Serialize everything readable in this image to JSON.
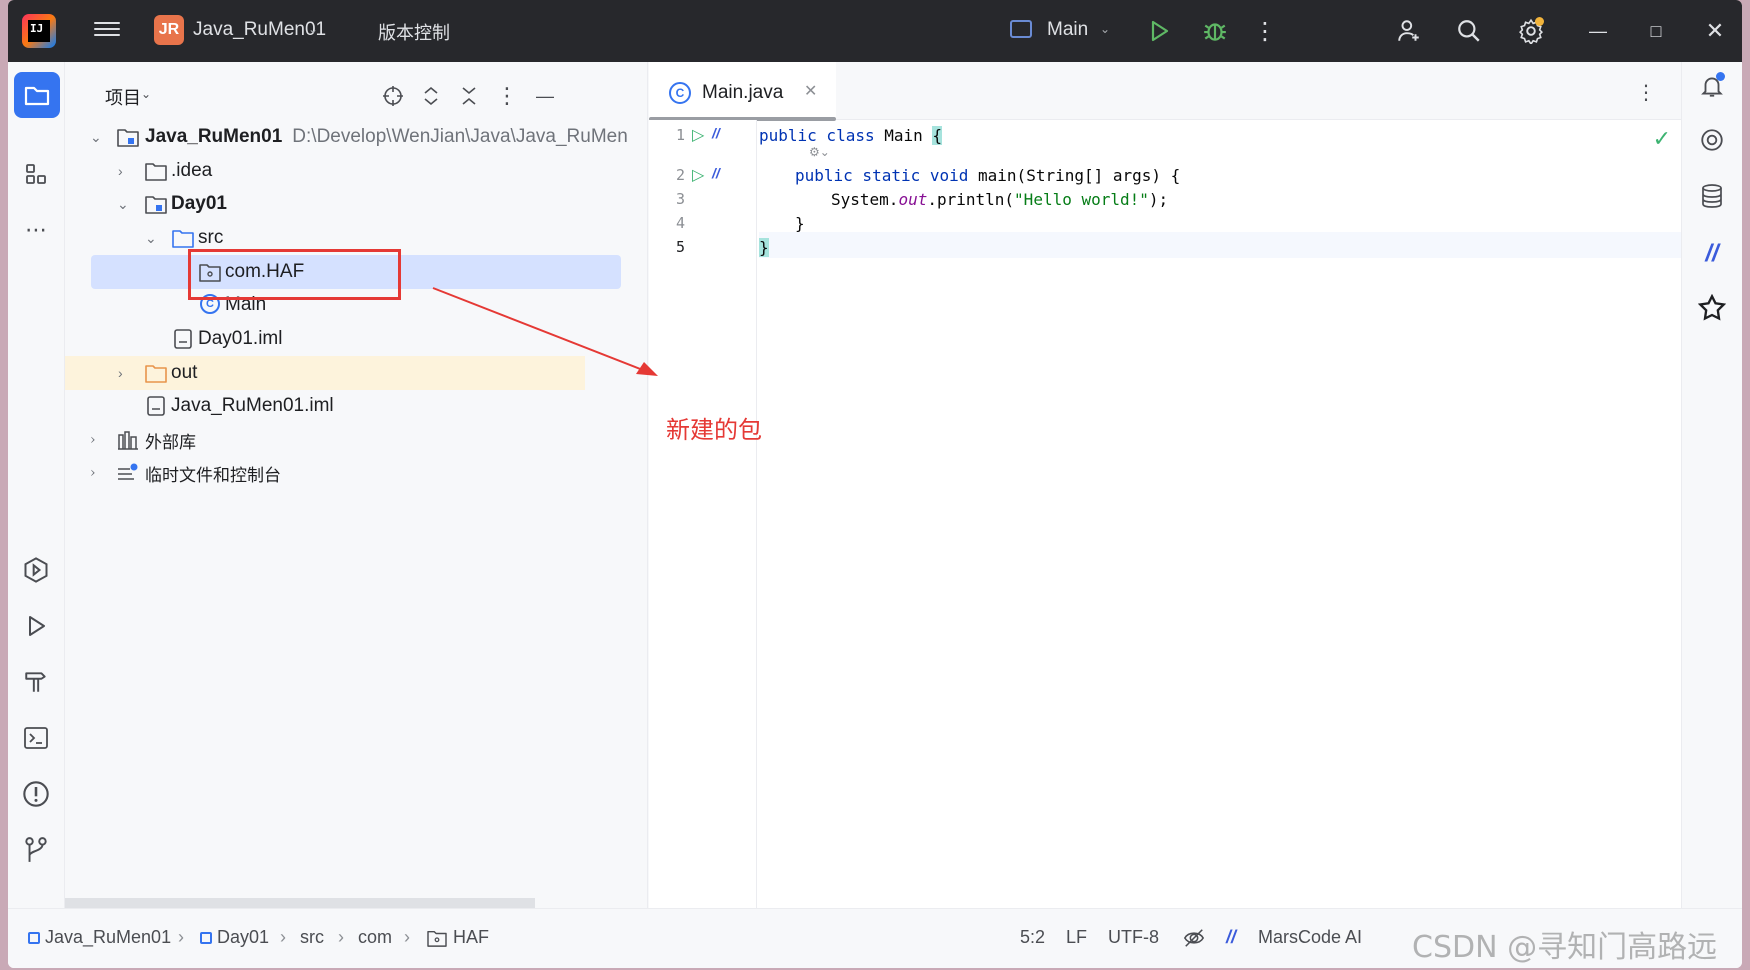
{
  "titlebar": {
    "project_badge": "JR",
    "project_name": "Java_RuMen01",
    "vcs_label": "版本控制",
    "run_config": "Main"
  },
  "project_panel": {
    "title": "项目",
    "tree": [
      {
        "label": "Java_RuMen01",
        "path": "D:\\Develop\\WenJian\\Java\\Java_RuMen"
      },
      {
        "label": ".idea"
      },
      {
        "label": "Day01"
      },
      {
        "label": "src"
      },
      {
        "label": "com.HAF"
      },
      {
        "label": "Main"
      },
      {
        "label": "Day01.iml"
      },
      {
        "label": "out"
      },
      {
        "label": "Java_RuMen01.iml"
      },
      {
        "label": "外部库"
      },
      {
        "label": "临时文件和控制台"
      }
    ]
  },
  "editor": {
    "tab_label": "Main.java",
    "line_numbers": [
      "1",
      "2",
      "3",
      "4",
      "5"
    ],
    "code": {
      "l1_kw": "public class",
      "l1_name": " Main ",
      "l1_brace": "{",
      "l2_kw": "public static void",
      "l2_rest": " main(String[] args) {",
      "l3_a": "System.",
      "l3_field": "out",
      "l3_b": ".println(",
      "l3_str": "\"Hello world!\"",
      "l3_c": ");",
      "l4": "}",
      "l5": "}"
    }
  },
  "annotation": {
    "text": "新建的包",
    "color": "#e53935"
  },
  "statusbar": {
    "breadcrumbs": [
      "Java_RuMen01",
      "Day01",
      "src",
      "com",
      "HAF"
    ],
    "position": "5:2",
    "line_ending": "LF",
    "encoding": "UTF-8",
    "plugin": "MarsCode AI",
    "watermark": "CSDN @寻知门高路远"
  },
  "colors": {
    "accent": "#3574f0",
    "titlebar": "#27282c",
    "selection": "#d5e1ff",
    "highlight_row": "#fdf3dc"
  },
  "icons": [
    "intellij-logo-icon",
    "hamburger-menu-icon",
    "run-icon",
    "debug-icon",
    "add-user-icon",
    "search-icon",
    "settings-icon",
    "folder-icon",
    "structure-icon",
    "notifications-icon",
    "database-icon",
    "terminal-icon",
    "git-icon"
  ]
}
